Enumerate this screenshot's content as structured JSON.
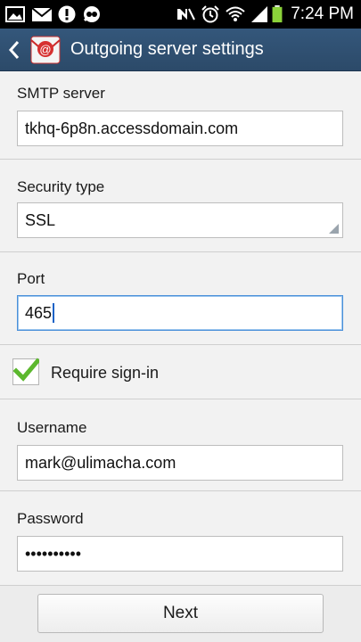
{
  "status_bar": {
    "time": "7:24 PM",
    "icons": [
      "gallery-icon",
      "mail-icon",
      "alert-icon",
      "voicemail-icon",
      "mute-icon",
      "alarm-icon",
      "wifi-icon",
      "signal-icon",
      "battery-icon"
    ]
  },
  "action_bar": {
    "title": "Outgoing server settings",
    "app_icon_glyph": "@"
  },
  "form": {
    "smtp_label": "SMTP server",
    "smtp_value": "tkhq-6p8n.accessdomain.com",
    "security_label": "Security type",
    "security_value": "SSL",
    "port_label": "Port",
    "port_value": "465",
    "require_signin_label": "Require sign-in",
    "require_signin_checked": true,
    "username_label": "Username",
    "username_value": "mark@ulimacha.com",
    "password_label": "Password",
    "password_value": "••••••••••"
  },
  "footer": {
    "next_label": "Next"
  },
  "colors": {
    "action_bar": "#2f4e6e",
    "check_green": "#5cb82e",
    "focus_border": "#4a90d9"
  }
}
